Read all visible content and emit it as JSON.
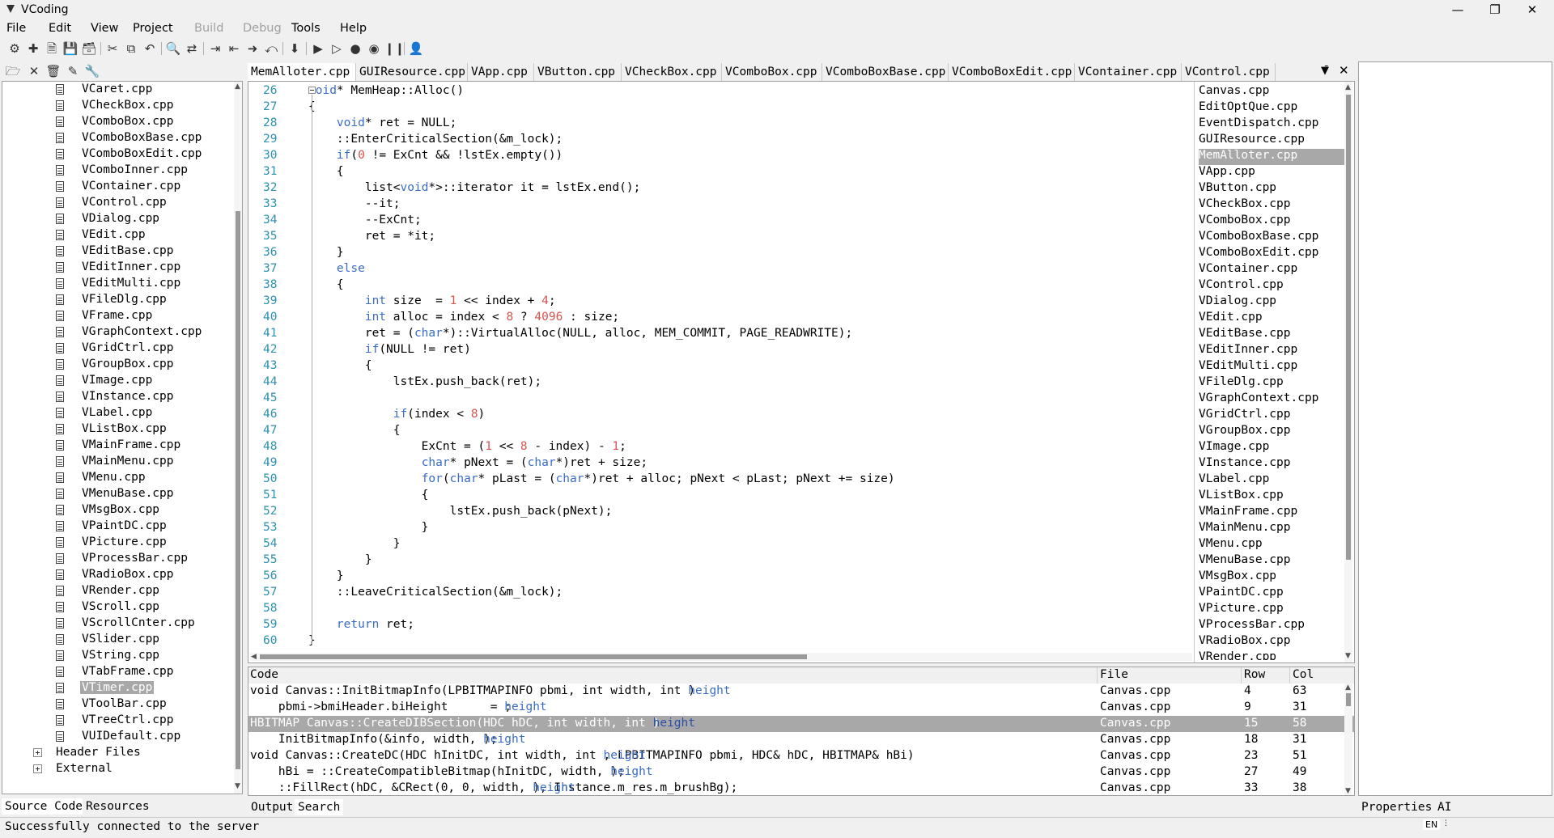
{
  "app": {
    "title": "VCoding"
  },
  "menu": [
    "File",
    "Edit",
    "View",
    "Project",
    "Build",
    "Debug",
    "Tools",
    "Help"
  ],
  "menu_disabled": [
    "Build",
    "Debug"
  ],
  "toolbar_icons": [
    "new-project-icon",
    "new-file-icon",
    "open-icon",
    "save-icon",
    "save-all-icon",
    "cut-icon",
    "copy-icon",
    "undo-icon",
    "find-icon",
    "replace-icon",
    "indent-icon",
    "outdent-icon",
    "go-icon",
    "back-icon",
    "download-icon",
    "run-icon",
    "debug-run-icon",
    "breakpoint-icon",
    "watch-icon",
    "pause-icon",
    "user-icon"
  ],
  "sidebar": {
    "files": [
      "VCaret.cpp",
      "VCheckBox.cpp",
      "VComboBox.cpp",
      "VComboBoxBase.cpp",
      "VComboBoxEdit.cpp",
      "VComboInner.cpp",
      "VContainer.cpp",
      "VControl.cpp",
      "VDialog.cpp",
      "VEdit.cpp",
      "VEditBase.cpp",
      "VEditInner.cpp",
      "VEditMulti.cpp",
      "VFileDlg.cpp",
      "VFrame.cpp",
      "VGraphContext.cpp",
      "VGridCtrl.cpp",
      "VGroupBox.cpp",
      "VImage.cpp",
      "VInstance.cpp",
      "VLabel.cpp",
      "VListBox.cpp",
      "VMainFrame.cpp",
      "VMainMenu.cpp",
      "VMenu.cpp",
      "VMenuBase.cpp",
      "VMsgBox.cpp",
      "VPaintDC.cpp",
      "VPicture.cpp",
      "VProcessBar.cpp",
      "VRadioBox.cpp",
      "VRender.cpp",
      "VScroll.cpp",
      "VScrollCnter.cpp",
      "VSlider.cpp",
      "VString.cpp",
      "VTabFrame.cpp",
      "VTimer.cpp",
      "VToolBar.cpp",
      "VTreeCtrl.cpp",
      "VUIDefault.cpp"
    ],
    "selected": "VTimer.cpp",
    "folders": [
      "Header Files",
      "External"
    ],
    "tabs": [
      "Source Code",
      "Resources"
    ]
  },
  "editor": {
    "tabs": [
      "MemAlloter.cpp",
      "GUIResource.cpp",
      "VApp.cpp",
      "VButton.cpp",
      "VCheckBox.cpp",
      "VComboBox.cpp",
      "VComboBoxBase.cpp",
      "VComboBoxEdit.cpp",
      "VContainer.cpp",
      "VControl.cpp"
    ],
    "active_tab": "MemAlloter.cpp",
    "line_numbers": [
      "26",
      "27",
      "28",
      "29",
      "30",
      "31",
      "32",
      "33",
      "34",
      "35",
      "36",
      "37",
      "38",
      "39",
      "40",
      "41",
      "42",
      "43",
      "44",
      "45",
      "46",
      "47",
      "48",
      "49",
      "50",
      "51",
      "52",
      "53",
      "54",
      "55",
      "56",
      "57",
      "58",
      "59",
      "60"
    ],
    "lines": [
      "void* MemHeap::Alloc()",
      "{",
      "    void* ret = NULL;",
      "    ::EnterCriticalSection(&m_lock);",
      "    if(0 != ExCnt && !lstEx.empty())",
      "    {",
      "        list<void*>::iterator it = lstEx.end();",
      "        --it;",
      "        --ExCnt;",
      "        ret = *it;",
      "    }",
      "    else",
      "    {",
      "        int size  = 1 << index + 4;",
      "        int alloc = index < 8 ? 4096 : size;",
      "        ret = (char*)::VirtualAlloc(NULL, alloc, MEM_COMMIT, PAGE_READWRITE);",
      "        if(NULL != ret)",
      "        {",
      "            lstEx.push_back(ret);",
      "",
      "            if(index < 8)",
      "            {",
      "                ExCnt = (1 << 8 - index) - 1;",
      "                char* pNext = (char*)ret + size;",
      "                for(char* pLast = (char*)ret + alloc; pNext < pLast; pNext += size)",
      "                {",
      "                    lstEx.push_back(pNext);",
      "                }",
      "            }",
      "        }",
      "    }",
      "    ::LeaveCriticalSection(&m_lock);",
      "",
      "    return ret;",
      "}"
    ],
    "open_files": [
      "Canvas.cpp",
      "EditOptQue.cpp",
      "EventDispatch.cpp",
      "GUIResource.cpp",
      "MemAlloter.cpp",
      "VApp.cpp",
      "VButton.cpp",
      "VCheckBox.cpp",
      "VComboBox.cpp",
      "VComboBoxBase.cpp",
      "VComboBoxEdit.cpp",
      "VContainer.cpp",
      "VControl.cpp",
      "VDialog.cpp",
      "VEdit.cpp",
      "VEditBase.cpp",
      "VEditInner.cpp",
      "VEditMulti.cpp",
      "VFileDlg.cpp",
      "VGraphContext.cpp",
      "VGridCtrl.cpp",
      "VGroupBox.cpp",
      "VImage.cpp",
      "VInstance.cpp",
      "VLabel.cpp",
      "VListBox.cpp",
      "VMainFrame.cpp",
      "VMainMenu.cpp",
      "VMenu.cpp",
      "VMenuBase.cpp",
      "VMsgBox.cpp",
      "VPaintDC.cpp",
      "VPicture.cpp",
      "VProcessBar.cpp",
      "VRadioBox.cpp",
      "VRender.cpp"
    ],
    "open_files_selected": "MemAlloter.cpp"
  },
  "results": {
    "headers": [
      "Code",
      "File",
      "Row",
      "Col"
    ],
    "rows": [
      {
        "code": "void Canvas::InitBitmapInfo(LPBITMAPINFO pbmi, int width, int height)",
        "file": "Canvas.cpp",
        "row": "4",
        "col": "63"
      },
      {
        "code": "    pbmi->bmiHeader.biHeight      = height;",
        "file": "Canvas.cpp",
        "row": "9",
        "col": "31"
      },
      {
        "code": "HBITMAP Canvas::CreateDIBSection(HDC hDC, int width, int height)",
        "file": "Canvas.cpp",
        "row": "15",
        "col": "58"
      },
      {
        "code": "    InitBitmapInfo(&info, width, height);",
        "file": "Canvas.cpp",
        "row": "18",
        "col": "31"
      },
      {
        "code": "void Canvas::CreateDC(HDC hInitDC, int width, int height, LPBITMAPINFO pbmi, HDC& hDC, HBITMAP& hBi)",
        "file": "Canvas.cpp",
        "row": "23",
        "col": "51"
      },
      {
        "code": "    hBi = ::CreateCompatibleBitmap(hInitDC, width, height);",
        "file": "Canvas.cpp",
        "row": "27",
        "col": "49"
      },
      {
        "code": "    ::FillRect(hDC, &CRect(0, 0, width, height), Instance.m_res.m_brushBg);",
        "file": "Canvas.cpp",
        "row": "33",
        "col": "38"
      }
    ],
    "selected_row": 2,
    "highlight_word": "height",
    "tabs": [
      "Output",
      "Search"
    ],
    "active_tab": "Search"
  },
  "right_panel": {
    "tabs": [
      "Properties",
      "AI"
    ]
  },
  "status": {
    "text": "Successfully connected to the server",
    "lang": "EN"
  }
}
